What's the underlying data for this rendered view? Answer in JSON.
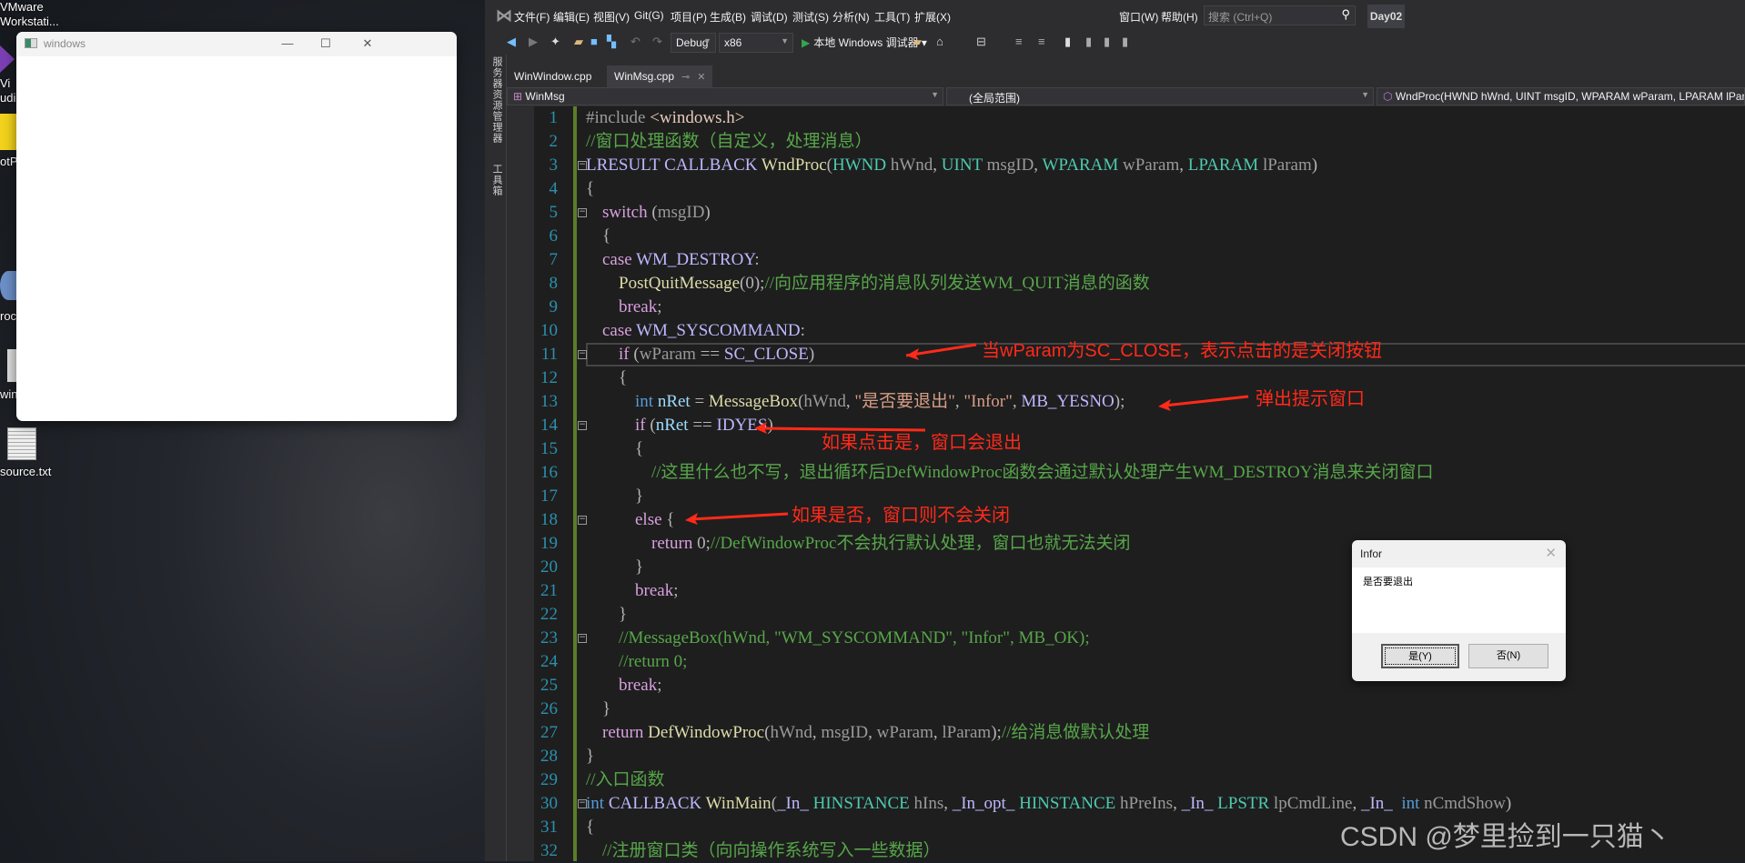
{
  "desktop": {
    "icons": [
      {
        "label": "VMware\nWorkstati...",
        "icon": "vmware-icon"
      },
      {
        "label": "Vi\nudi",
        "icon": "visual-studio-icon"
      },
      {
        "label": "otPl",
        "icon": "potplayer-icon"
      },
      {
        "label": "roce",
        "icon": "process-explorer-icon"
      },
      {
        "label": "win_",
        "icon": "text-file-icon"
      },
      {
        "label": "source.txt",
        "icon": "text-file-icon"
      }
    ]
  },
  "app_window": {
    "title": "windows",
    "minimize": "—",
    "maximize": "☐",
    "close": "✕"
  },
  "vs": {
    "menu": [
      "文件(F)",
      "编辑(E)",
      "视图(V)",
      "Git(G)",
      "项目(P)",
      "生成(B)",
      "调试(D)",
      "测试(S)",
      "分析(N)",
      "工具(T)",
      "扩展(X)",
      "窗口(W)",
      "帮助(H)"
    ],
    "search_placeholder": "搜索 (Ctrl+Q)",
    "project_name": "Day02",
    "toolbar": {
      "config": "Debug",
      "platform": "x86",
      "run_label": "本地 Windows 调试器"
    },
    "side_panels": [
      "服务器资源管理器",
      "工具箱"
    ],
    "tabs": [
      {
        "label": "WinWindow.cpp",
        "active": false
      },
      {
        "label": "WinMsg.cpp",
        "active": true,
        "pin": "⊸",
        "close": "✕"
      }
    ],
    "nav": {
      "project": "WinMsg",
      "scope": "(全局范围)",
      "member": "WndProc(HWND hWnd, UINT msgID, WPARAM wParam, LPARAM lParam)"
    },
    "colors": {
      "line_number": "#2b91af",
      "comment": "#57a64a",
      "keyword": "#d8a0df",
      "type": "#4ec9b0",
      "function": "#dcdcaa",
      "macro": "#beb7ff",
      "annotation": "#ff2a1a"
    },
    "code": [
      {
        "n": "1",
        "indent": 0,
        "tokens": [
          [
            "pp",
            "#include "
          ],
          [
            "inc",
            "<windows.h>"
          ]
        ]
      },
      {
        "n": "2",
        "indent": 0,
        "tokens": [
          [
            "cm",
            "//窗口处理函数（自定义，处理消息）"
          ]
        ]
      },
      {
        "n": "3",
        "indent": 0,
        "fold": true,
        "tokens": [
          [
            "mac",
            "LRESULT "
          ],
          [
            "mac",
            "CALLBACK "
          ],
          [
            "fn",
            "WndProc"
          ],
          [
            "p",
            "("
          ],
          [
            "ty",
            "HWND "
          ],
          [
            "par",
            "hWnd"
          ],
          [
            "p",
            ", "
          ],
          [
            "ty",
            "UINT "
          ],
          [
            "par",
            "msgID"
          ],
          [
            "p",
            ", "
          ],
          [
            "ty",
            "WPARAM "
          ],
          [
            "par",
            "wParam"
          ],
          [
            "p",
            ", "
          ],
          [
            "ty",
            "LPARAM "
          ],
          [
            "par",
            "lParam"
          ],
          [
            "p",
            ")"
          ]
        ]
      },
      {
        "n": "4",
        "indent": 0,
        "tokens": [
          [
            "p",
            "{"
          ]
        ]
      },
      {
        "n": "5",
        "indent": 1,
        "fold": true,
        "tokens": [
          [
            "kw",
            "switch "
          ],
          [
            "p",
            "("
          ],
          [
            "par",
            "msgID"
          ],
          [
            "p",
            ")"
          ]
        ]
      },
      {
        "n": "6",
        "indent": 1,
        "tokens": [
          [
            "p",
            "{"
          ]
        ]
      },
      {
        "n": "7",
        "indent": 1,
        "tokens": [
          [
            "kw",
            "case "
          ],
          [
            "mac",
            "WM_DESTROY"
          ],
          [
            "p",
            ":"
          ]
        ]
      },
      {
        "n": "8",
        "indent": 2,
        "tokens": [
          [
            "fn",
            "PostQuitMessage"
          ],
          [
            "p",
            "(0);"
          ],
          [
            "cm",
            "//向应用程序的消息队列发送WM_QUIT消息的函数"
          ]
        ]
      },
      {
        "n": "9",
        "indent": 2,
        "tokens": [
          [
            "kw",
            "break"
          ],
          [
            "p",
            ";"
          ]
        ]
      },
      {
        "n": "10",
        "indent": 1,
        "tokens": [
          [
            "kw",
            "case "
          ],
          [
            "mac",
            "WM_SYSCOMMAND"
          ],
          [
            "p",
            ":"
          ]
        ]
      },
      {
        "n": "11",
        "indent": 2,
        "fold": true,
        "current": true,
        "tokens": [
          [
            "kw",
            "if "
          ],
          [
            "p",
            "("
          ],
          [
            "par",
            "wParam"
          ],
          [
            "p",
            " == "
          ],
          [
            "mac",
            "SC_CLOSE"
          ],
          [
            "p",
            ")"
          ]
        ]
      },
      {
        "n": "12",
        "indent": 2,
        "tokens": [
          [
            "p",
            "{"
          ]
        ]
      },
      {
        "n": "13",
        "indent": 3,
        "tokens": [
          [
            "blue",
            "int "
          ],
          [
            "var",
            "nRet"
          ],
          [
            "p",
            " = "
          ],
          [
            "fn",
            "MessageBox"
          ],
          [
            "p",
            "("
          ],
          [
            "par",
            "hWnd"
          ],
          [
            "p",
            ", "
          ],
          [
            "str",
            "\"是否要退出\""
          ],
          [
            "p",
            ", "
          ],
          [
            "str",
            "\"Infor\""
          ],
          [
            "p",
            ", "
          ],
          [
            "mac",
            "MB_YESNO"
          ],
          [
            "p",
            ");"
          ]
        ]
      },
      {
        "n": "14",
        "indent": 3,
        "fold": true,
        "tokens": [
          [
            "kw",
            "if "
          ],
          [
            "p",
            "("
          ],
          [
            "var",
            "nRet"
          ],
          [
            "p",
            " == "
          ],
          [
            "mac",
            "IDYES"
          ],
          [
            "p",
            ")"
          ]
        ]
      },
      {
        "n": "15",
        "indent": 3,
        "tokens": [
          [
            "p",
            "{"
          ]
        ]
      },
      {
        "n": "16",
        "indent": 4,
        "tokens": [
          [
            "cm",
            "//这里什么也不写，退出循环后DefWindowProc函数会通过默认处理产生WM_DESTROY消息来关闭窗口"
          ]
        ]
      },
      {
        "n": "17",
        "indent": 3,
        "tokens": [
          [
            "p",
            "}"
          ]
        ]
      },
      {
        "n": "18",
        "indent": 3,
        "fold": true,
        "tokens": [
          [
            "kw",
            "else "
          ],
          [
            "p",
            "{"
          ]
        ]
      },
      {
        "n": "19",
        "indent": 4,
        "tokens": [
          [
            "kw",
            "return "
          ],
          [
            "p",
            "0;"
          ],
          [
            "cm",
            "//DefWindowProc不会执行默认处理，窗口也就无法关闭"
          ]
        ]
      },
      {
        "n": "20",
        "indent": 3,
        "tokens": [
          [
            "p",
            "}"
          ]
        ]
      },
      {
        "n": "21",
        "indent": 3,
        "tokens": [
          [
            "kw",
            "break"
          ],
          [
            "p",
            ";"
          ]
        ]
      },
      {
        "n": "22",
        "indent": 2,
        "tokens": [
          [
            "p",
            "}"
          ]
        ]
      },
      {
        "n": "23",
        "indent": 2,
        "fold": true,
        "tokens": [
          [
            "cm",
            "//MessageBox(hWnd, \"WM_SYSCOMMAND\", \"Infor\", MB_OK);"
          ]
        ]
      },
      {
        "n": "24",
        "indent": 2,
        "tokens": [
          [
            "cm",
            "//return 0;"
          ]
        ]
      },
      {
        "n": "25",
        "indent": 2,
        "tokens": [
          [
            "kw",
            "break"
          ],
          [
            "p",
            ";"
          ]
        ]
      },
      {
        "n": "26",
        "indent": 1,
        "tokens": [
          [
            "p",
            "}"
          ]
        ]
      },
      {
        "n": "27",
        "indent": 1,
        "tokens": [
          [
            "kw",
            "return "
          ],
          [
            "fn",
            "DefWindowProc"
          ],
          [
            "p",
            "("
          ],
          [
            "par",
            "hWnd"
          ],
          [
            "p",
            ", "
          ],
          [
            "par",
            "msgID"
          ],
          [
            "p",
            ", "
          ],
          [
            "par",
            "wParam"
          ],
          [
            "p",
            ", "
          ],
          [
            "par",
            "lParam"
          ],
          [
            "p",
            ");"
          ],
          [
            "cm",
            "//给消息做默认处理"
          ]
        ]
      },
      {
        "n": "28",
        "indent": 0,
        "tokens": [
          [
            "p",
            "}"
          ]
        ]
      },
      {
        "n": "29",
        "indent": 0,
        "tokens": [
          [
            "cm",
            "//入口函数"
          ]
        ]
      },
      {
        "n": "30",
        "indent": 0,
        "fold": true,
        "tokens": [
          [
            "blue",
            "int "
          ],
          [
            "mac",
            "CALLBACK "
          ],
          [
            "fn",
            "WinMain"
          ],
          [
            "p",
            "("
          ],
          [
            "mac",
            "_In_ "
          ],
          [
            "ty",
            "HINSTANCE "
          ],
          [
            "par",
            "hIns"
          ],
          [
            "p",
            ", "
          ],
          [
            "mac",
            "_In_opt_ "
          ],
          [
            "ty",
            "HINSTANCE "
          ],
          [
            "par",
            "hPreIns"
          ],
          [
            "p",
            ", "
          ],
          [
            "mac",
            "_In_ "
          ],
          [
            "ty",
            "LPSTR "
          ],
          [
            "par",
            "lpCmdLine"
          ],
          [
            "p",
            ", "
          ],
          [
            "mac",
            "_In_  "
          ],
          [
            "blue",
            "int "
          ],
          [
            "par",
            "nCmdShow"
          ],
          [
            "p",
            ")"
          ]
        ]
      },
      {
        "n": "31",
        "indent": 0,
        "tokens": [
          [
            "p",
            "{"
          ]
        ]
      },
      {
        "n": "32",
        "indent": 1,
        "tokens": [
          [
            "cm",
            "//注册窗口类（向向操作系统写入一些数据）"
          ]
        ]
      }
    ]
  },
  "annotations": [
    "当wParam为SC_CLOSE，表示点击的是关闭按钮",
    "弹出提示窗口",
    "如果点击是，窗口会退出",
    "如果是否，窗口则不会关闭"
  ],
  "dialog": {
    "title": "Infor",
    "close": "✕",
    "message": "是否要退出",
    "yes": "是(Y)",
    "no": "否(N)"
  },
  "watermark": "CSDN @梦里捡到一只猫丶"
}
